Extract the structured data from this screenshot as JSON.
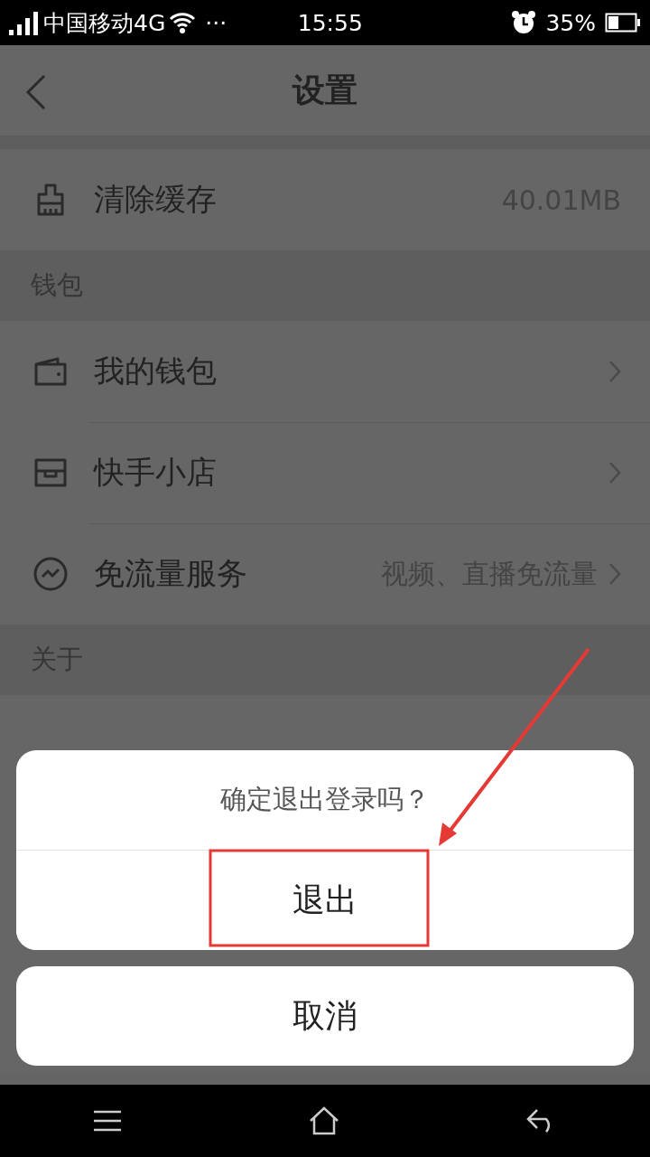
{
  "status_bar": {
    "carrier": "中国移动4G",
    "more": "···",
    "time": "15:55",
    "battery": "35%"
  },
  "header": {
    "title": "设置"
  },
  "list": [
    {
      "kind": "row",
      "label": "清除缓存",
      "value": "40.01MB",
      "chevron": false
    },
    {
      "kind": "section",
      "label": "钱包"
    },
    {
      "kind": "row",
      "label": "我的钱包",
      "chevron": true
    },
    {
      "kind": "row",
      "label": "快手小店",
      "chevron": true
    },
    {
      "kind": "row",
      "label": "免流量服务",
      "value": "视频、直播免流量",
      "chevron": true
    },
    {
      "kind": "section",
      "label": "关于"
    }
  ],
  "dialog": {
    "message": "确定退出登录吗？",
    "confirm": "退出",
    "cancel": "取消"
  }
}
